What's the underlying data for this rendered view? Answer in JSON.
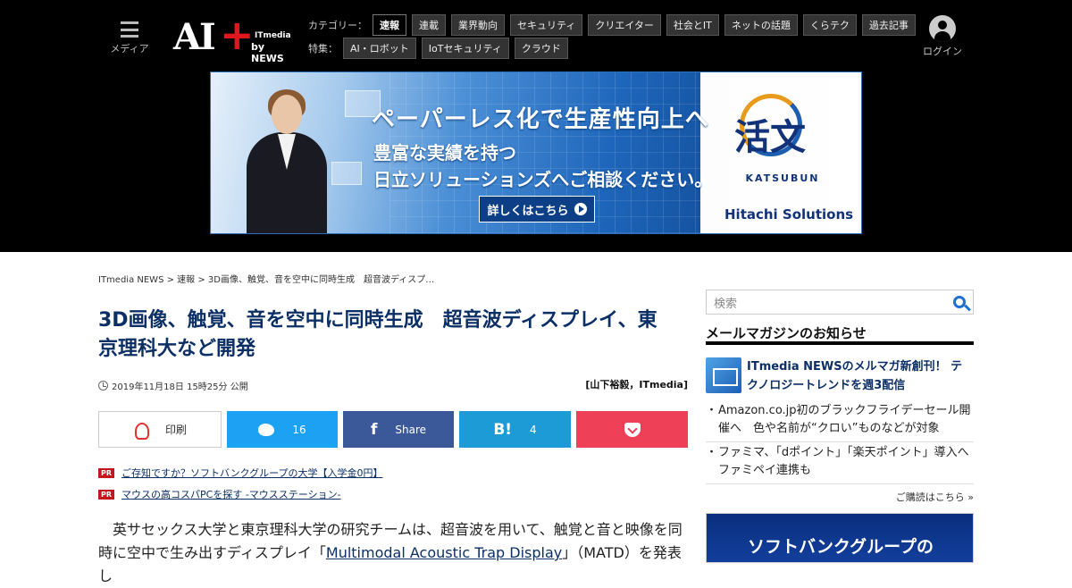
{
  "header": {
    "menu_label": "メディア",
    "logo_main": "AI",
    "logo_plus": "+",
    "logo_itmedia": "ITmedia",
    "logo_by": "by NEWS",
    "category_label": "カテゴリー：",
    "categories": [
      "速報",
      "連載",
      "業界動向",
      "セキュリティ",
      "クリエイター",
      "社会とIT",
      "ネットの話題",
      "くらテク",
      "過去記事"
    ],
    "feature_label": "特集：",
    "features": [
      "AI・ロボット",
      "IoTセキュリティ",
      "クラウド"
    ],
    "login_label": "ログイン"
  },
  "ad_banner": {
    "headline": "ペーパーレス化で生産性向上へ",
    "line2": "豊富な実績を持つ",
    "line3": "日立ソリューションズへご相談ください。",
    "cta": "詳しくはこちら",
    "brand_kanji": "活文",
    "brand_roman": "KATSUBUN",
    "company": "Hitachi Solutions"
  },
  "breadcrumb": "ITmedia NEWS > 速報 > 3D画像、触覚、音を空中に同時生成　超音波ディスプ…",
  "article": {
    "title": "3D画像、触覚、音を空中に同時生成　超音波ディスプレイ、東京理科大など開発",
    "date": "2019年11月18日 15時25分 公開",
    "author": "[山下裕毅，ITmedia]",
    "body_pre": "　英サセックス大学と東京理科大学の研究チームは、超音波を用いて、触覚と音と映像を同時に空中で生み出すディスプレイ「",
    "body_link": "Multimodal Acoustic Trap Display",
    "body_post": "」（MATD）を発表し"
  },
  "share": {
    "print_label": "印刷",
    "twitter_count": "16",
    "facebook_label": "Share",
    "hatena_icon": "B!",
    "hatena_count": "4"
  },
  "pr": [
    {
      "badge": "PR",
      "text": "ご存知ですか？ソフトバンクグループの大学【入学金0円】"
    },
    {
      "badge": "PR",
      "text": "マウスの高コスパPCを探す -マウスステーション-"
    }
  ],
  "sidebar": {
    "search_placeholder": "検索",
    "mail_heading": "メールマガジンのお知らせ",
    "mail_feature": "ITmedia NEWSのメルマガ新創刊！ テクノロジートレンドを週3配信",
    "mail_items": [
      "Amazon.co.jp初のブラックフライデーセール開催へ　色や名前が“クロい”ものなどが対象",
      "ファミマ、「dポイント」「楽天ポイント」導入へ　ファミペイ連携も"
    ],
    "mail_more": "ご購読はこちら »",
    "side_ad_text": "ソフトバンクグループの"
  },
  "colors": {
    "header_bg": "#000000",
    "title": "#0c2f66",
    "twitter": "#1da1f2",
    "facebook": "#3b5998",
    "hatena": "#1d9bd7",
    "pocket": "#ee4056"
  }
}
